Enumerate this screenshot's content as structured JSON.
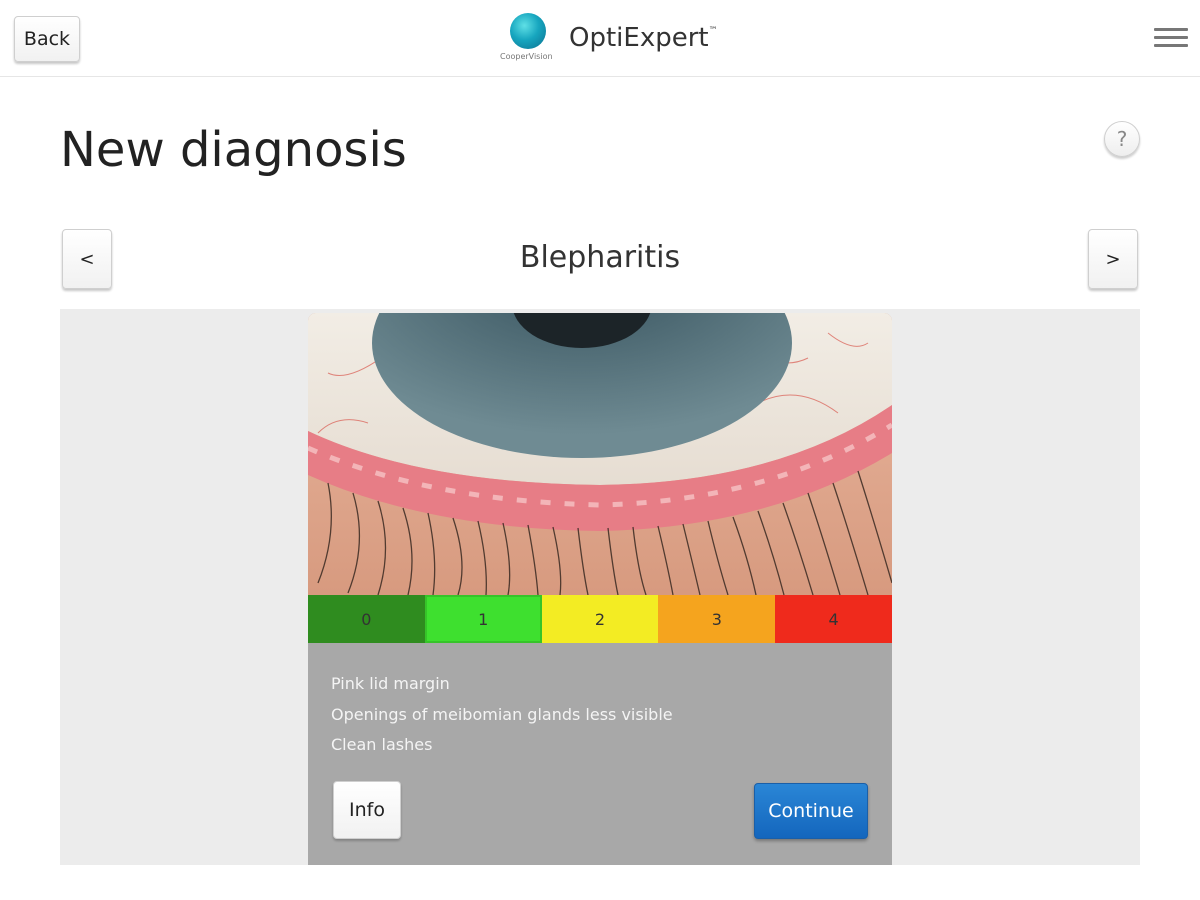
{
  "header": {
    "back_label": "Back",
    "app_name": "OptiExpert",
    "trademark": "™",
    "brand_sub": "CooperVision"
  },
  "page": {
    "title": "New diagnosis",
    "help_glyph": "?"
  },
  "section": {
    "title": "Blepharitis",
    "prev_glyph": "<",
    "next_glyph": ">"
  },
  "grading": {
    "scale": [
      {
        "label": "0",
        "color": "#2f8c1f"
      },
      {
        "label": "1",
        "color": "#3ee02f"
      },
      {
        "label": "2",
        "color": "#f3ec23"
      },
      {
        "label": "3",
        "color": "#f5a41e"
      },
      {
        "label": "4",
        "color": "#ef2a1c"
      }
    ],
    "selected": "1"
  },
  "description": {
    "lines": [
      "Pink lid margin",
      "Openings of meibomian glands less visible",
      "Clean lashes"
    ]
  },
  "actions": {
    "info_label": "Info",
    "continue_label": "Continue"
  },
  "colors": {
    "accent": "#1a73c9",
    "card_bg": "#a8a8a8",
    "panel_bg": "#ececec"
  }
}
